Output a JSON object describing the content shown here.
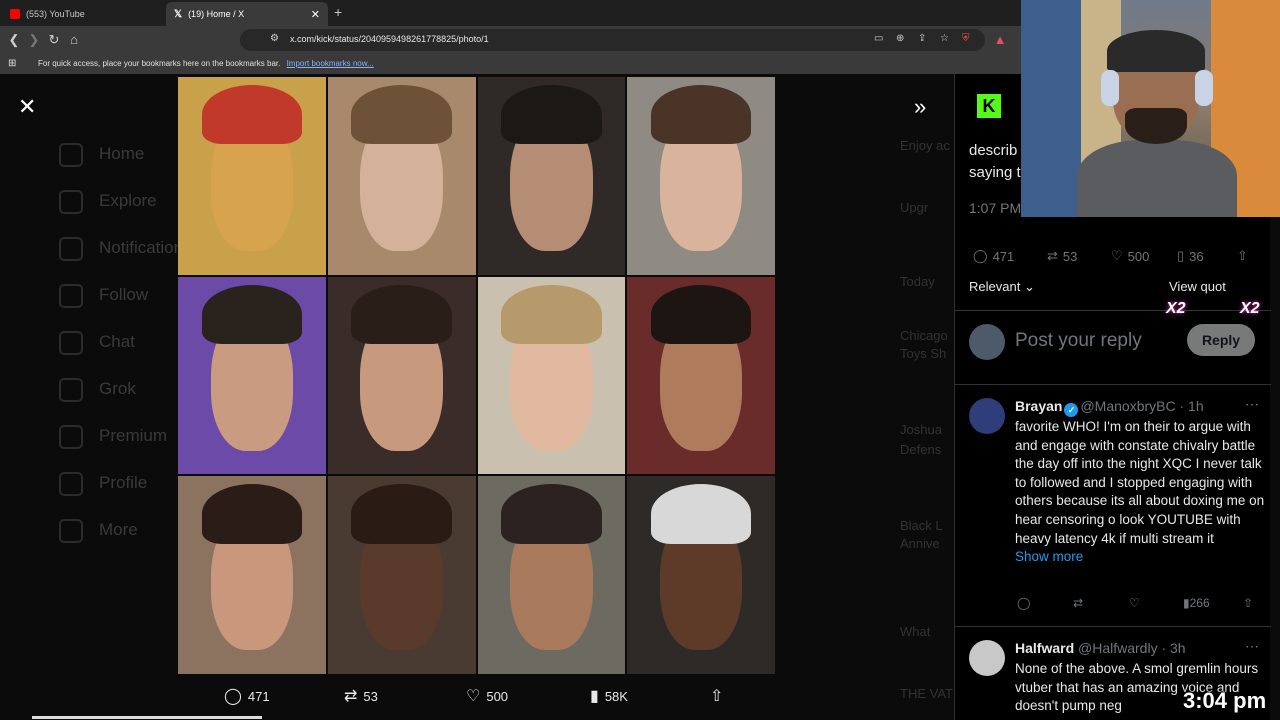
{
  "browser": {
    "tabs": [
      {
        "title": "(553) YouTube",
        "favicon_color": "#ff0000"
      },
      {
        "title": "(19) Home / X",
        "favicon_color": "#ffffff"
      }
    ],
    "new_tab": "+",
    "url": "x.com/kick/status/2040959498261778825/photo/1",
    "bookmarks_text": "For quick access, place your bookmarks here on the bookmarks bar.",
    "bookmarks_link": "Import bookmarks now..."
  },
  "background_nav": [
    "Home",
    "Explore",
    "Notifications",
    "Follow",
    "Chat",
    "Grok",
    "Premium",
    "Profile",
    "More"
  ],
  "background_side": [
    "Enjoy ac",
    "Upgr",
    "Today",
    "Chicago",
    "Toys Sh",
    "Joshua",
    "Defens",
    "Black L",
    "Annive",
    "What",
    "THE VAT"
  ],
  "collage": {
    "cells": [
      {
        "bg": "#c9a14a",
        "face": "#d7a34f",
        "hair": "#c0392b"
      },
      {
        "bg": "#a8896c",
        "face": "#d4b199",
        "hair": "#6e5238"
      },
      {
        "bg": "#2f2a27",
        "face": "#b58c74",
        "hair": "#1c1816"
      },
      {
        "bg": "#8f8a83",
        "face": "#d9b39b",
        "hair": "#4a3428"
      },
      {
        "bg": "#6b4aa8",
        "face": "#c99b80",
        "hair": "#2a221d"
      },
      {
        "bg": "#3a2c28",
        "face": "#c79a80",
        "hair": "#2a1e18"
      },
      {
        "bg": "#c9c0b0",
        "face": "#e0b9a0",
        "hair": "#b69a6c"
      },
      {
        "bg": "#6a2b2b",
        "face": "#b07a5c",
        "hair": "#1d1512"
      },
      {
        "bg": "#8c7360",
        "face": "#c9977c",
        "hair": "#2a1c16"
      },
      {
        "bg": "#4a3b32",
        "face": "#5a3a2a",
        "hair": "#2a1b14"
      },
      {
        "bg": "#6d6a62",
        "face": "#a97a5c",
        "hair": "#2c2320"
      },
      {
        "bg": "#2d2a28",
        "face": "#5e3b28",
        "hair": "#d8d8d8"
      }
    ]
  },
  "media_actions": {
    "replies": "471",
    "reposts": "53",
    "likes": "500",
    "views": "58K"
  },
  "post": {
    "author_initial": "K",
    "text_line1": "describ",
    "text_line2": "saying t",
    "time": "1:07 PM",
    "replies": "471",
    "reposts": "53",
    "likes": "500",
    "bookmarks": "36",
    "sort": "Relevant",
    "view_quotes": "View quot"
  },
  "reply_composer": {
    "placeholder": "Post your reply",
    "button": "Reply"
  },
  "replies": [
    {
      "name": "Brayan",
      "handle": "@ManoxbryBC · 1h",
      "text": "favorite WHO! I'm on their to argue with and engage with constate chivalry battle the day off into the night XQC I never talk to followed and I stopped engaging with others because its all about doxing me on hear censoring o look YOUTUBE with heavy latency 4k if multi stream it",
      "show_more": "Show more",
      "views": "266"
    },
    {
      "name": "Halfward",
      "handle": "@Halfwardly · 3h",
      "text": "None of the above. A smol gremlin hours vtuber that has an amazing voice and doesn't pump neg"
    }
  ],
  "overlay": {
    "clock": "3:04 pm",
    "badge": "X2"
  },
  "icons": {
    "back": "back-arrow-icon",
    "forward": "forward-arrow-icon",
    "reload": "reload-icon",
    "home": "home-icon",
    "close": "close-icon",
    "expand": "chevron-double-right-icon"
  },
  "colors": {
    "kick_green": "#53fc18",
    "link_blue": "#1d9bf0",
    "muted": "#71767b"
  }
}
